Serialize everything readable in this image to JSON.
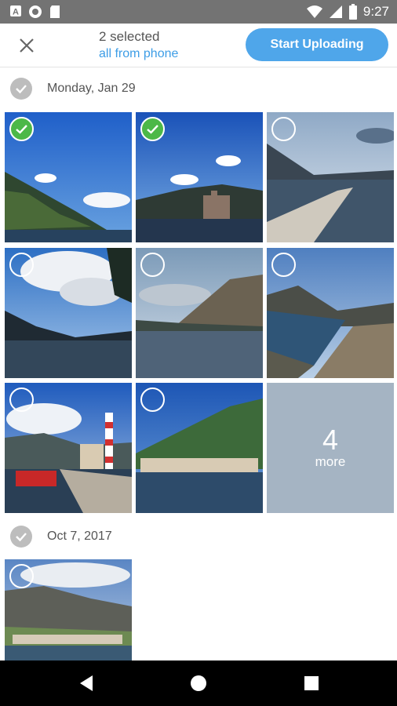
{
  "status_bar": {
    "time": "9:27",
    "left_icons": [
      "app-a-icon",
      "circle-app-icon",
      "sd-card-icon"
    ],
    "right_icons": [
      "wifi-icon",
      "signal-icon",
      "battery-icon"
    ]
  },
  "header": {
    "close_icon": "close-icon",
    "selection_count": "2 selected",
    "selection_scope": "all from phone",
    "upload_button": "Start Uploading"
  },
  "groups": [
    {
      "date": "Monday, Jan 29",
      "photos": [
        {
          "scene": "blue sky over mountains and bay",
          "selected": true
        },
        {
          "scene": "castle by water under blue sky",
          "selected": true
        },
        {
          "scene": "stone pier on calm bay",
          "selected": false
        },
        {
          "scene": "dramatic clouds over dark water",
          "selected": false
        },
        {
          "scene": "mountain ridge over sea",
          "selected": false
        },
        {
          "scene": "aerial view of bay and town",
          "selected": false
        },
        {
          "scene": "harbor with red boat and lighthouse",
          "selected": false
        },
        {
          "scene": "coastal village below green hill",
          "selected": false
        }
      ],
      "more_tile": {
        "count": "4",
        "label": "more"
      }
    },
    {
      "date": "Oct 7, 2017",
      "photos": [
        {
          "scene": "mountains above coastal town",
          "selected": false
        }
      ]
    }
  ],
  "nav_bar": {
    "icons": [
      "back-icon",
      "home-icon",
      "recents-icon"
    ]
  },
  "colors": {
    "accent": "#4fa6ea",
    "link": "#3d9de6",
    "selected_check": "#4cb848",
    "status_bar": "#737373"
  }
}
